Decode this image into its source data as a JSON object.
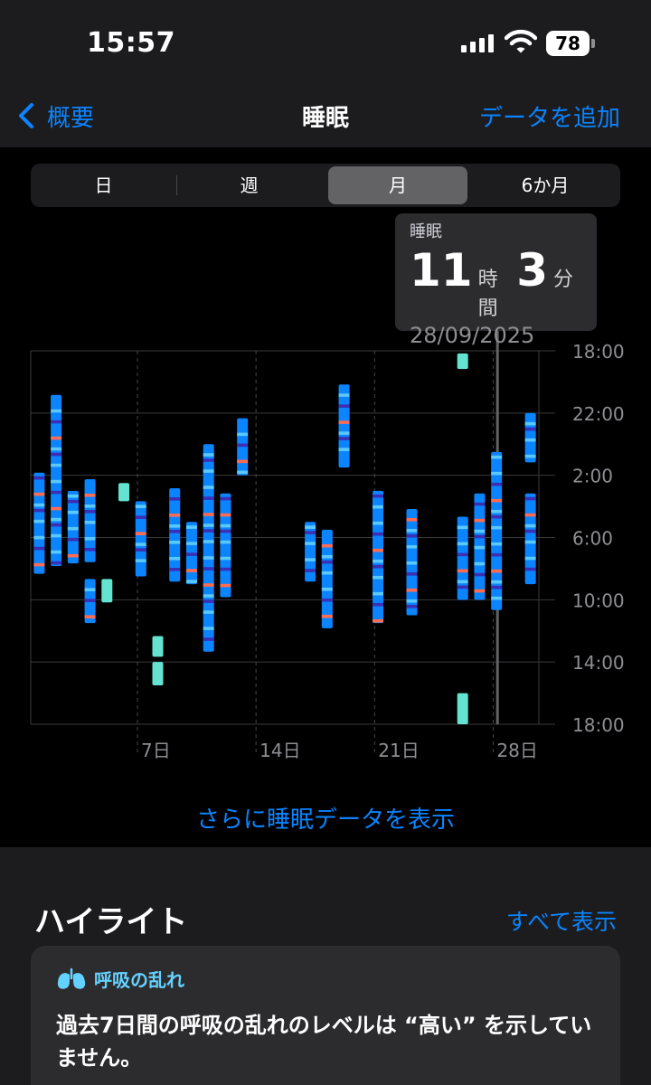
{
  "status_bar": {
    "time": "15:57",
    "battery": "78"
  },
  "nav": {
    "back_label": "概要",
    "title": "睡眠",
    "add_label": "データを追加"
  },
  "segments": [
    {
      "label": "日",
      "selected": false
    },
    {
      "label": "週",
      "selected": false
    },
    {
      "label": "月",
      "selected": true
    },
    {
      "label": "6か月",
      "selected": false
    }
  ],
  "tooltip": {
    "label": "睡眠",
    "hours": "11",
    "hours_unit": "時間",
    "minutes": "3",
    "minutes_unit": "分",
    "date": "28/09/2025"
  },
  "chart_data": {
    "type": "range-bar",
    "y_ticks": [
      "18:00",
      "22:00",
      "2:00",
      "6:00",
      "10:00",
      "14:00",
      "18:00"
    ],
    "y_range_hours_from_18": [
      0,
      24
    ],
    "x_tick_labels": [
      "7日",
      "14日",
      "21日",
      "28日"
    ],
    "x_tick_days": [
      7,
      14,
      21,
      28
    ],
    "days_in_month": 30,
    "selected_day": 28,
    "series": [
      {
        "day": 1,
        "start": "1:50",
        "end": "8:20"
      },
      {
        "day": 2,
        "start": "20:50",
        "end": "7:50"
      },
      {
        "day": 3,
        "start": "3:00",
        "end": "7:40"
      },
      {
        "day": 4,
        "start": "2:15",
        "end": "7:35"
      },
      {
        "day": 4,
        "start": "8:40",
        "end": "11:30"
      },
      {
        "day": 5,
        "start": "8:40",
        "end": "10:10"
      },
      {
        "day": 6,
        "start": "2:30",
        "end": "3:40"
      },
      {
        "day": 7,
        "start": "3:40",
        "end": "8:30"
      },
      {
        "day": 8,
        "start": "12:20",
        "end": "13:40"
      },
      {
        "day": 8,
        "start": "14:00",
        "end": "15:30"
      },
      {
        "day": 9,
        "start": "2:50",
        "end": "8:50"
      },
      {
        "day": 10,
        "start": "5:00",
        "end": "9:00"
      },
      {
        "day": 11,
        "start": "0:00",
        "end": "13:20"
      },
      {
        "day": 12,
        "start": "3:10",
        "end": "9:50"
      },
      {
        "day": 13,
        "start": "22:20",
        "end": "2:00"
      },
      {
        "day": 17,
        "start": "5:00",
        "end": "8:50"
      },
      {
        "day": 18,
        "start": "5:30",
        "end": "11:50"
      },
      {
        "day": 19,
        "start": "20:10",
        "end": "1:30"
      },
      {
        "day": 21,
        "start": "3:00",
        "end": "11:30"
      },
      {
        "day": 23,
        "start": "4:10",
        "end": "11:00"
      },
      {
        "day": 26,
        "start": "16:00",
        "end": "18:00"
      },
      {
        "day": 26,
        "start": "4:40",
        "end": "10:00"
      },
      {
        "day": 26,
        "start": "18:10",
        "end": "19:10"
      },
      {
        "day": 27,
        "start": "3:10",
        "end": "10:00"
      },
      {
        "day": 28,
        "start": "0:30",
        "end": "10:40"
      },
      {
        "day": 30,
        "start": "22:00",
        "end": "1:10"
      },
      {
        "day": 30,
        "start": "3:10",
        "end": "9:00"
      }
    ],
    "colors": {
      "core": "#0a84ff",
      "deep": "#3a2fb5",
      "rem": "#5ac8fa",
      "awake": "#ff6b52",
      "nap": "#64e3d0"
    }
  },
  "more_link": "さらに睡眠データを表示",
  "highlights": {
    "title": "ハイライト",
    "show_all": "すべて表示",
    "card": {
      "category": "呼吸の乱れ",
      "body": "過去7日間の呼吸の乱れのレベルは “高い” を示していません。"
    }
  }
}
